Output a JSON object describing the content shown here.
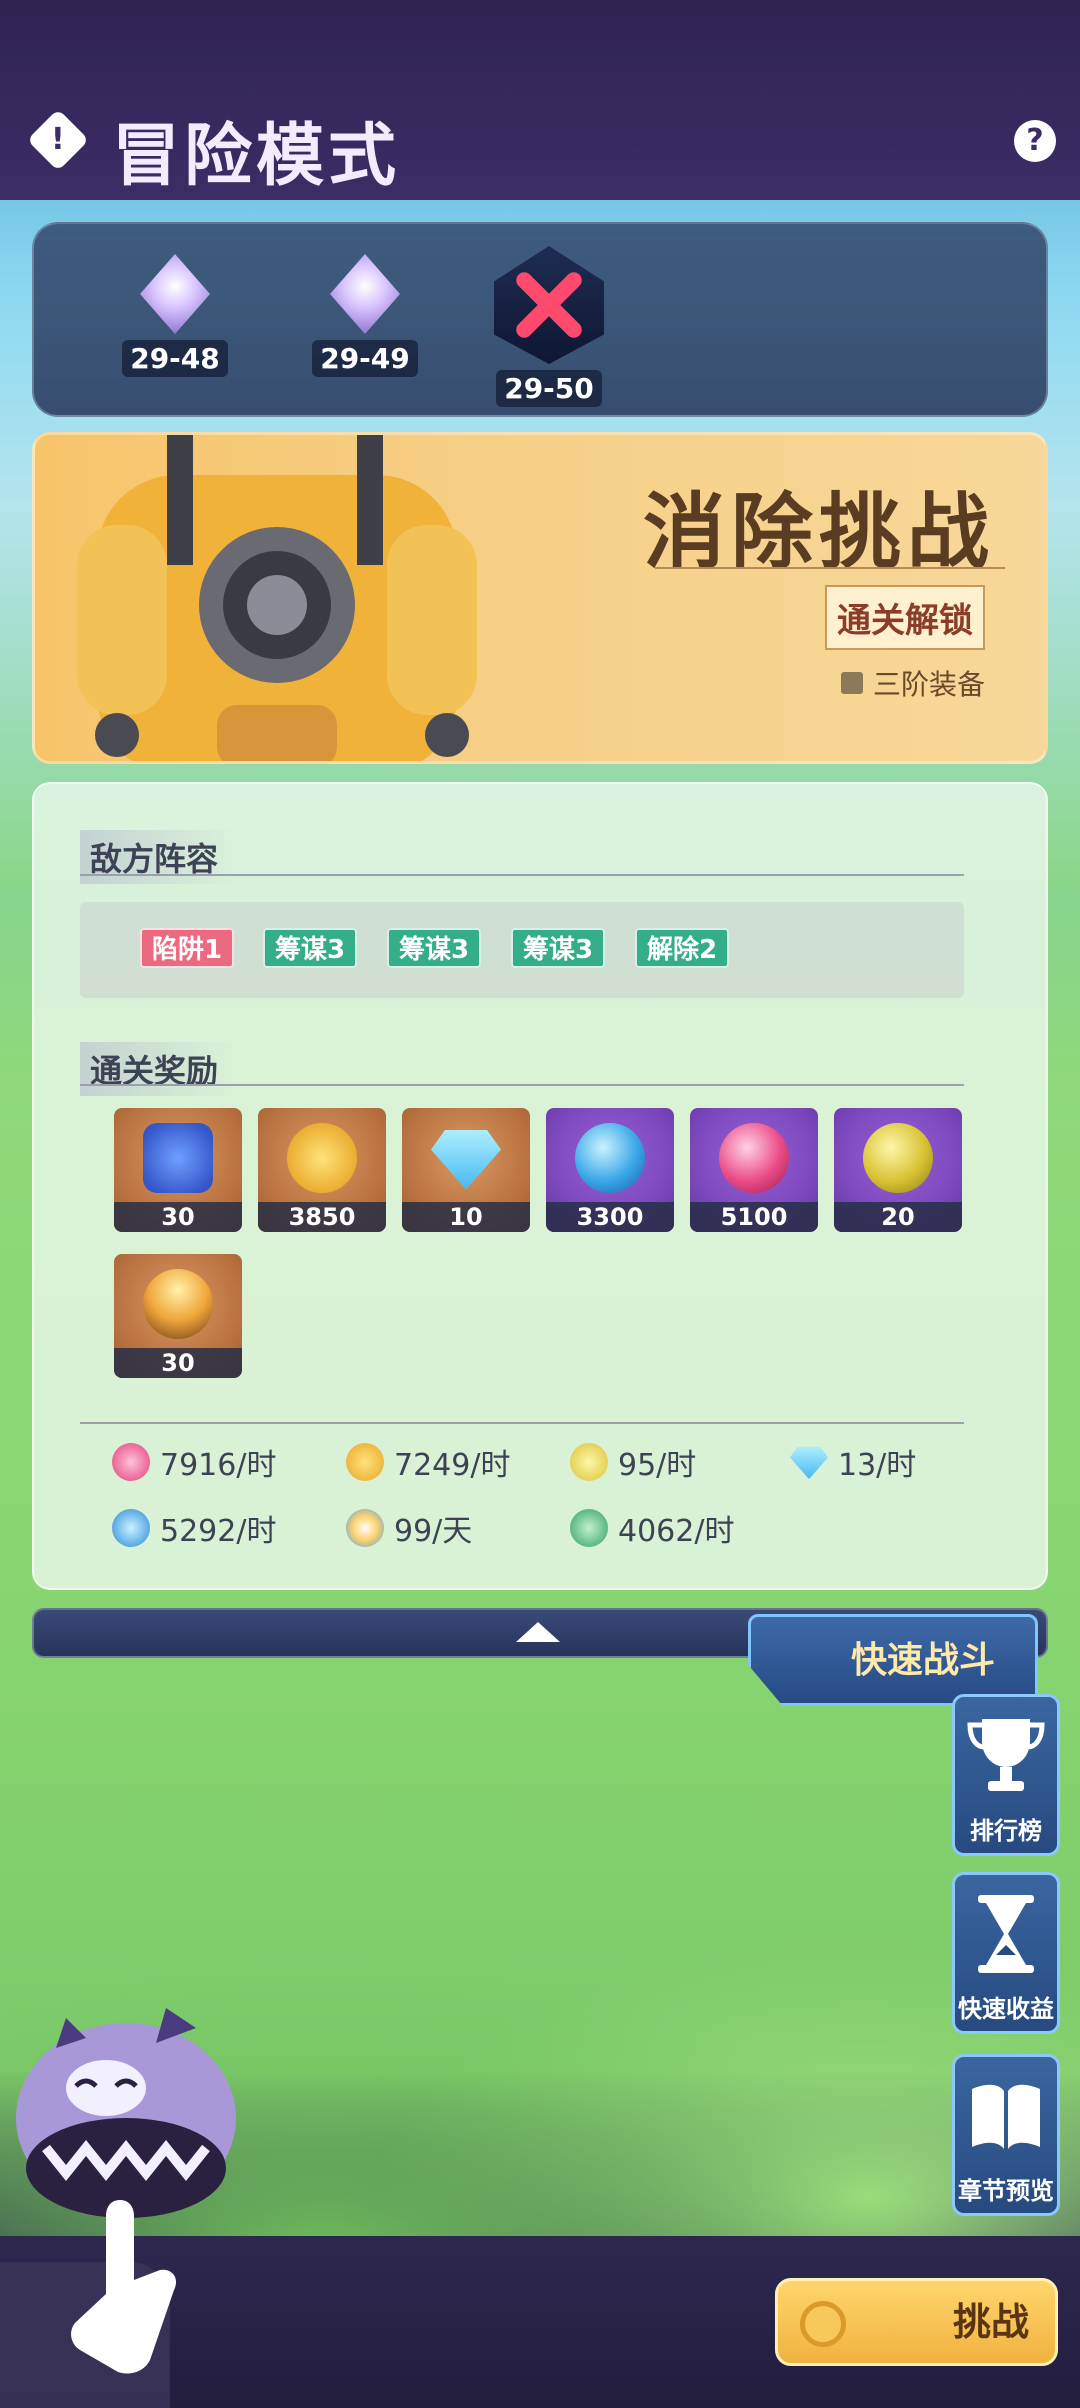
{
  "header": {
    "title": "冒险模式",
    "info_glyph": "!",
    "help_glyph": "?"
  },
  "stages": [
    {
      "label": "29-48",
      "type": "cleared"
    },
    {
      "label": "29-49",
      "type": "cleared"
    },
    {
      "label": "29-50",
      "type": "boss"
    }
  ],
  "banner": {
    "title": "消除挑战",
    "unlock_badge": "通关解锁",
    "equipment": "三阶装备"
  },
  "enemy_section": {
    "title": "敌方阵容"
  },
  "tags": [
    {
      "label": "陷阱1",
      "color": "#ec6a80"
    },
    {
      "label": "筹谋3",
      "color": "#34ae88"
    },
    {
      "label": "筹谋3",
      "color": "#34ae88"
    },
    {
      "label": "筹谋3",
      "color": "#34ae88"
    },
    {
      "label": "解除2",
      "color": "#34ae88"
    }
  ],
  "reward_section": {
    "title": "通关奖励"
  },
  "rewards": [
    {
      "icon": "puzzle-sword-icon",
      "qty": "30",
      "bg": "brown"
    },
    {
      "icon": "gold-coin-icon",
      "qty": "3850",
      "bg": "brown"
    },
    {
      "icon": "diamond-icon",
      "qty": "10",
      "bg": "brown"
    },
    {
      "icon": "blue-orb-icon",
      "qty": "3300",
      "bg": "purple"
    },
    {
      "icon": "pink-orb-icon",
      "qty": "5100",
      "bg": "purple"
    },
    {
      "icon": "gold-sword-orb-icon",
      "qty": "20",
      "bg": "purple"
    },
    {
      "icon": "flame-orb-icon",
      "qty": "30",
      "bg": "brown"
    }
  ],
  "rates": [
    {
      "icon": "pink-orb-icon",
      "value": "7916/时"
    },
    {
      "icon": "gold-coin-icon",
      "value": "7249/时"
    },
    {
      "icon": "gold-sword-orb-icon",
      "value": "95/时"
    },
    {
      "icon": "diamond-icon",
      "value": "13/时"
    },
    {
      "icon": "blue-orb-icon",
      "value": "5292/时"
    },
    {
      "icon": "compass-icon",
      "value": "99/天"
    },
    {
      "icon": "temple-icon",
      "value": "4062/时"
    }
  ],
  "quick_battle": "快速战斗",
  "side_buttons": [
    {
      "label": "排行榜",
      "icon": "trophy-icon"
    },
    {
      "label": "快速收益",
      "icon": "hourglass-icon"
    },
    {
      "label": "章节预览",
      "icon": "book-icon"
    }
  ],
  "challenge": "挑战",
  "colors": {
    "accent": "#f0b23f",
    "panel": "#3a66a0",
    "header": "#3c2d66"
  }
}
